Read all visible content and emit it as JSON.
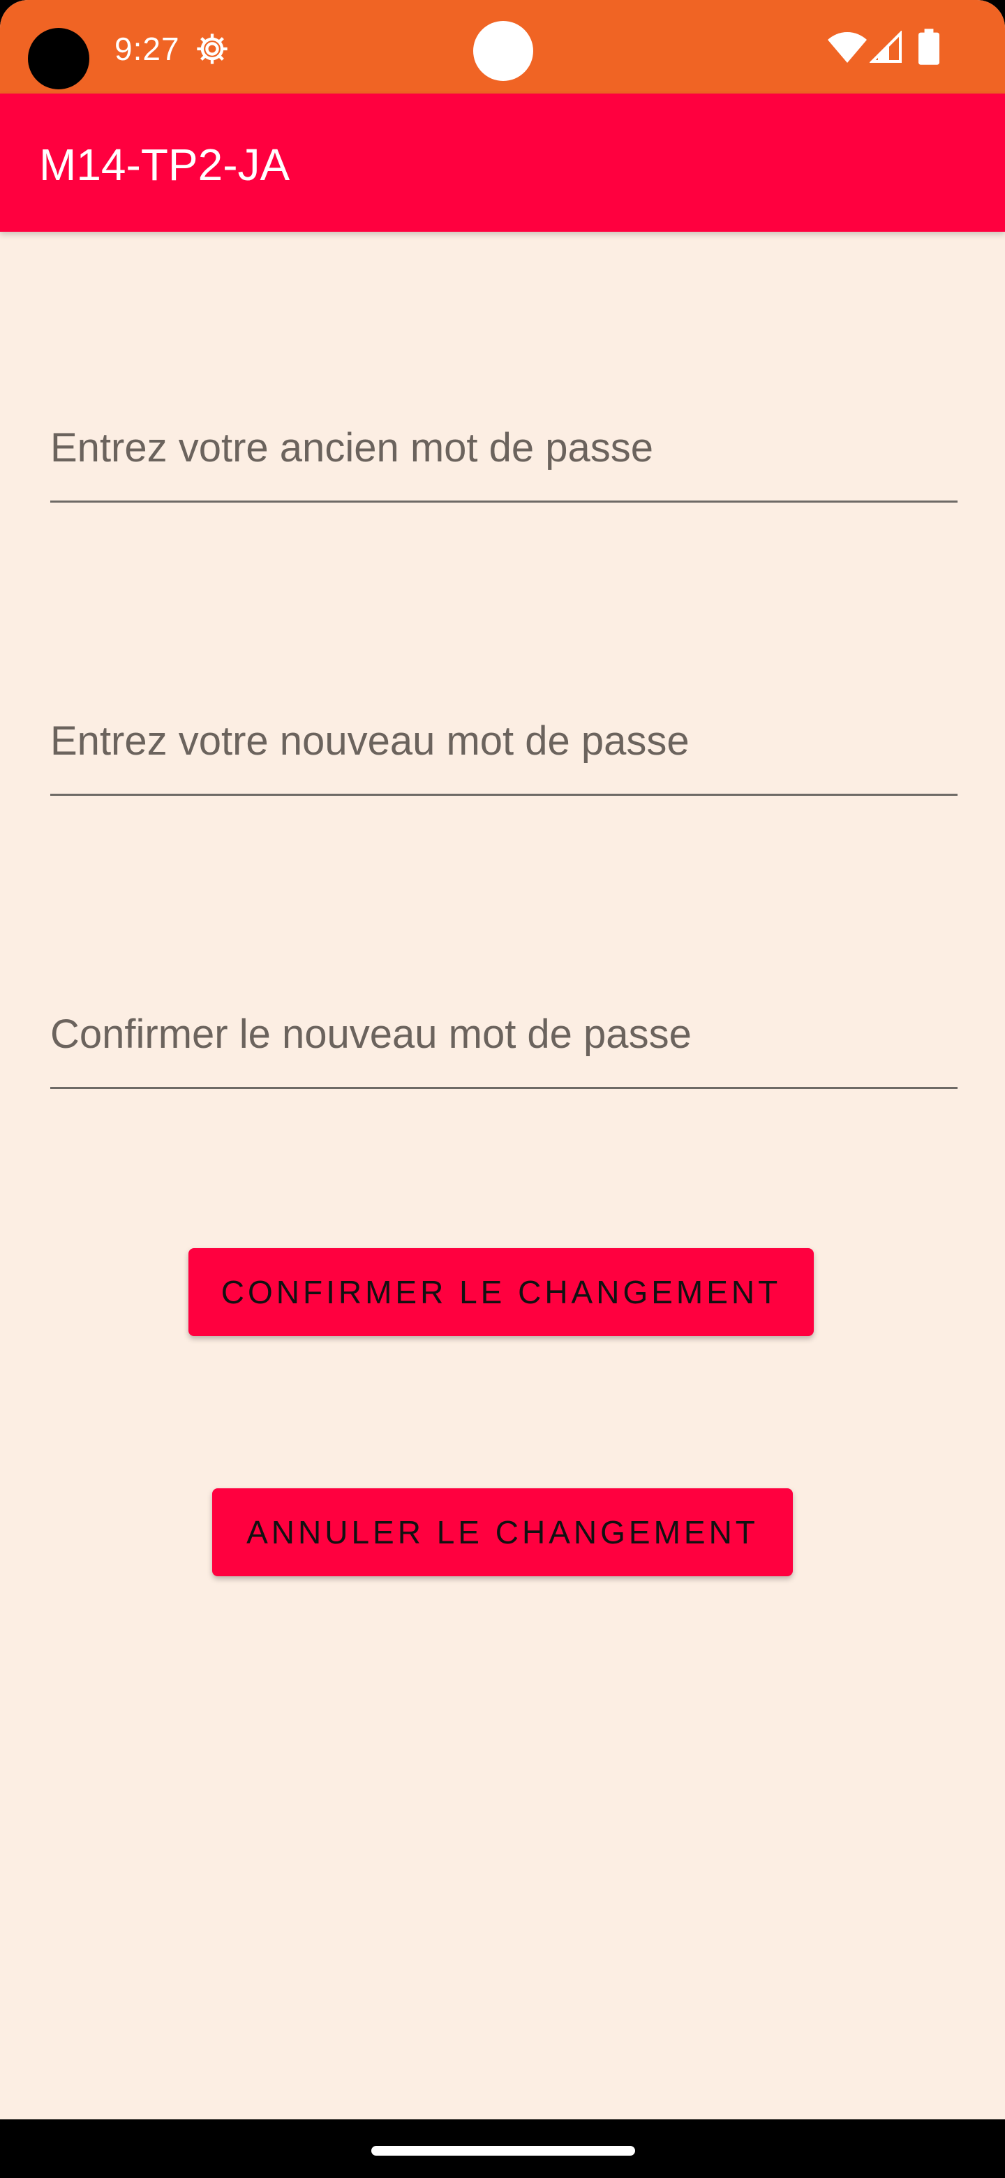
{
  "status_bar": {
    "time": "9:27",
    "icons": [
      "gear-icon",
      "wifi-icon",
      "signal-icon",
      "battery-icon"
    ],
    "color": "#F06424"
  },
  "app_bar": {
    "title": "M14-TP2-JA",
    "color": "#FF003F"
  },
  "form": {
    "old_password": {
      "placeholder": "Entrez votre ancien mot de passe",
      "value": ""
    },
    "new_password": {
      "placeholder": "Entrez votre nouveau mot de passe",
      "value": ""
    },
    "confirm_password": {
      "placeholder": "Confirmer le nouveau mot de passe",
      "value": ""
    }
  },
  "buttons": {
    "confirm_label": "CONFIRMER LE CHANGEMENT",
    "cancel_label": "ANNULER LE CHANGEMENT",
    "color": "#FF003F"
  },
  "background_color": "#FCEEE3"
}
